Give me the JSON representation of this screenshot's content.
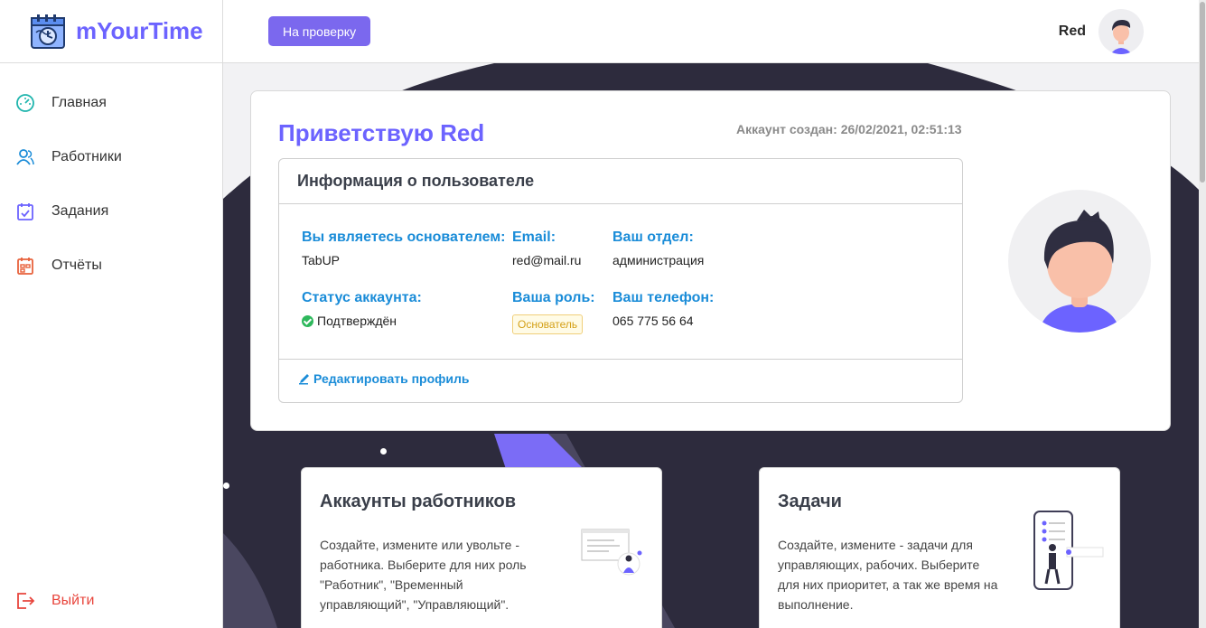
{
  "app": {
    "name": "mYourTime"
  },
  "sidebar": {
    "items": [
      {
        "label": "Главная",
        "icon": "dashboard-icon"
      },
      {
        "label": "Работники",
        "icon": "users-icon"
      },
      {
        "label": "Задания",
        "icon": "tasks-icon"
      },
      {
        "label": "Отчёты",
        "icon": "reports-icon"
      }
    ],
    "logout_label": "Выйти"
  },
  "topbar": {
    "review_button": "На проверку",
    "user_name": "Red"
  },
  "welcome": {
    "greeting": "Приветствую Red",
    "created": "Аккаунт создан: 26/02/2021, 02:51:13"
  },
  "user_info": {
    "title": "Информация о пользователе",
    "founder_label": "Вы являетесь основателем:",
    "founder_value": "TabUP",
    "email_label": "Email:",
    "email_value": "red@mail.ru",
    "department_label": "Ваш отдел:",
    "department_value": "администрация",
    "status_label": "Статус аккаунта:",
    "status_value": "Подтверждён",
    "role_label": "Ваша роль:",
    "role_value": "Основатель",
    "phone_label": "Ваш телефон:",
    "phone_value": "065 775 56 64",
    "edit_label": "Редактировать профиль"
  },
  "cards": [
    {
      "title": "Аккаунты работников",
      "description": "Создайте, измените или увольте - работника. Выберите для них роль \"Работник\", \"Временный управляющий\", \"Управляющий\"."
    },
    {
      "title": "Задачи",
      "description": "Создайте, измените - задачи для управляющих, рабочих. Выберите для них приоритет, а так же время на выполнение."
    }
  ],
  "colors": {
    "accent": "#6c63ff",
    "link": "#1a8cd8",
    "danger": "#e8453c",
    "dark_bg": "#2d2b3d"
  }
}
